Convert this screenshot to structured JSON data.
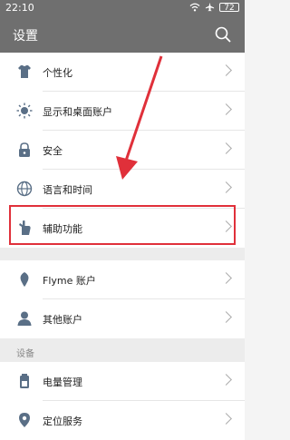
{
  "status_bar": {
    "time": "22:10",
    "battery": "72"
  },
  "header": {
    "title": "设置"
  },
  "groups": [
    {
      "items": [
        {
          "label": "个性化",
          "icon": "shirt-icon"
        },
        {
          "label": "显示和桌面账户",
          "icon": "brightness-icon"
        },
        {
          "label": "安全",
          "icon": "lock-icon"
        },
        {
          "label": "语言和时间",
          "icon": "globe-icon"
        },
        {
          "label": "辅助功能",
          "icon": "hand-icon"
        }
      ]
    },
    {
      "items": [
        {
          "label": "Flyme 账户",
          "icon": "flyme-icon"
        },
        {
          "label": "其他账户",
          "icon": "person-icon"
        }
      ]
    }
  ],
  "section_device": {
    "title": "设备"
  },
  "device_items": [
    {
      "label": "电量管理",
      "icon": "battery-icon"
    },
    {
      "label": "定位服务",
      "icon": "location-icon"
    }
  ],
  "annotation": {
    "highlight_color": "#e0303a"
  }
}
